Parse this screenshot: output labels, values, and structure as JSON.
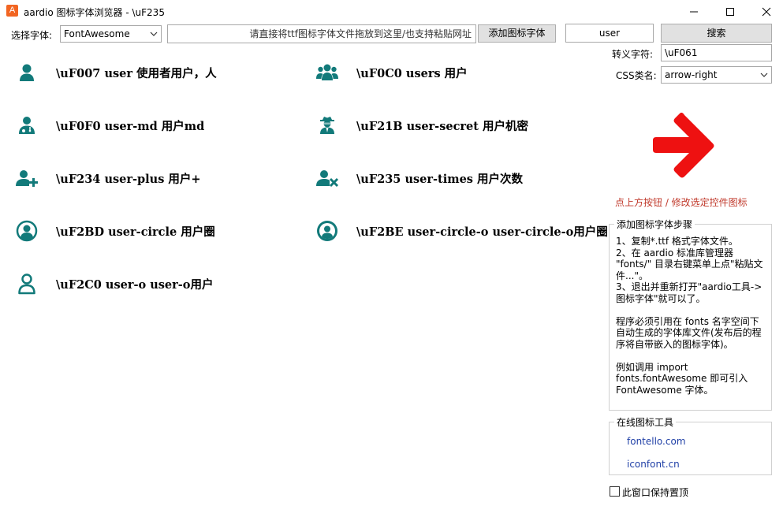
{
  "window": {
    "logo": "A",
    "title": "aardio 图标字体浏览器 -  \\uF235"
  },
  "toolbar": {
    "font_label": "选择字体:",
    "font_select_value": "FontAwesome",
    "drop_placeholder": "请直接将ttf图标字体文件拖放到这里/也支持粘贴网址",
    "add_font_button": "添加图标字体",
    "search_value": "user",
    "search_button": "搜索"
  },
  "details": {
    "escape_label": "转义字符:",
    "escape_value": "\\uF061",
    "css_label": "CSS类名:",
    "css_value": "arrow-right",
    "hint": "点上方按钮 / 修改选定控件图标"
  },
  "icons": [
    {
      "name": "user-icon",
      "caption": "\\uF007 user 使用者用户，人"
    },
    {
      "name": "users-icon",
      "caption": "\\uF0C0 users 用户"
    },
    {
      "name": "user-md-icon",
      "caption": "\\uF0F0 user-md 用户md"
    },
    {
      "name": "user-secret-icon",
      "caption": "\\uF21B user-secret 用户机密"
    },
    {
      "name": "user-plus-icon",
      "caption": "\\uF234 user-plus 用户+"
    },
    {
      "name": "user-times-icon",
      "caption": "\\uF235 user-times 用户次数"
    },
    {
      "name": "user-circle-icon",
      "caption": "\\uF2BD user-circle 用户圈"
    },
    {
      "name": "user-circle-o-icon",
      "caption": "\\uF2BE user-circle-o user-circle-o用户圈"
    },
    {
      "name": "user-o-icon",
      "caption": "\\uF2C0 user-o user-o用户"
    }
  ],
  "steps_group": {
    "title": "添加图标字体步骤",
    "lines": [
      "1、复制*.ttf 格式字体文件。",
      "2、在 aardio 标准库管理器 \"fonts/\" 目录右键菜单上点\"粘贴文件...\"。",
      "3、退出并重新打开\"aardio工具->图标字体\"就可以了。",
      "",
      "程序必须引用在 fonts 名字空间下自动生成的字体库文件(发布后的程序将自带嵌入的图标字体)。",
      "",
      "例如调用 import fonts.fontAwesome 即可引入 FontAwesome 字体。"
    ]
  },
  "online_group": {
    "title": "在线图标工具",
    "links": [
      "fontello.com",
      "iconfont.cn"
    ]
  },
  "topmost_checkbox": {
    "label": "此窗口保持置顶",
    "checked": false
  },
  "colors": {
    "icon": "#127a7a",
    "arrow": "#ee1111",
    "hint": "#c0392b",
    "link": "#1f3fa6"
  }
}
